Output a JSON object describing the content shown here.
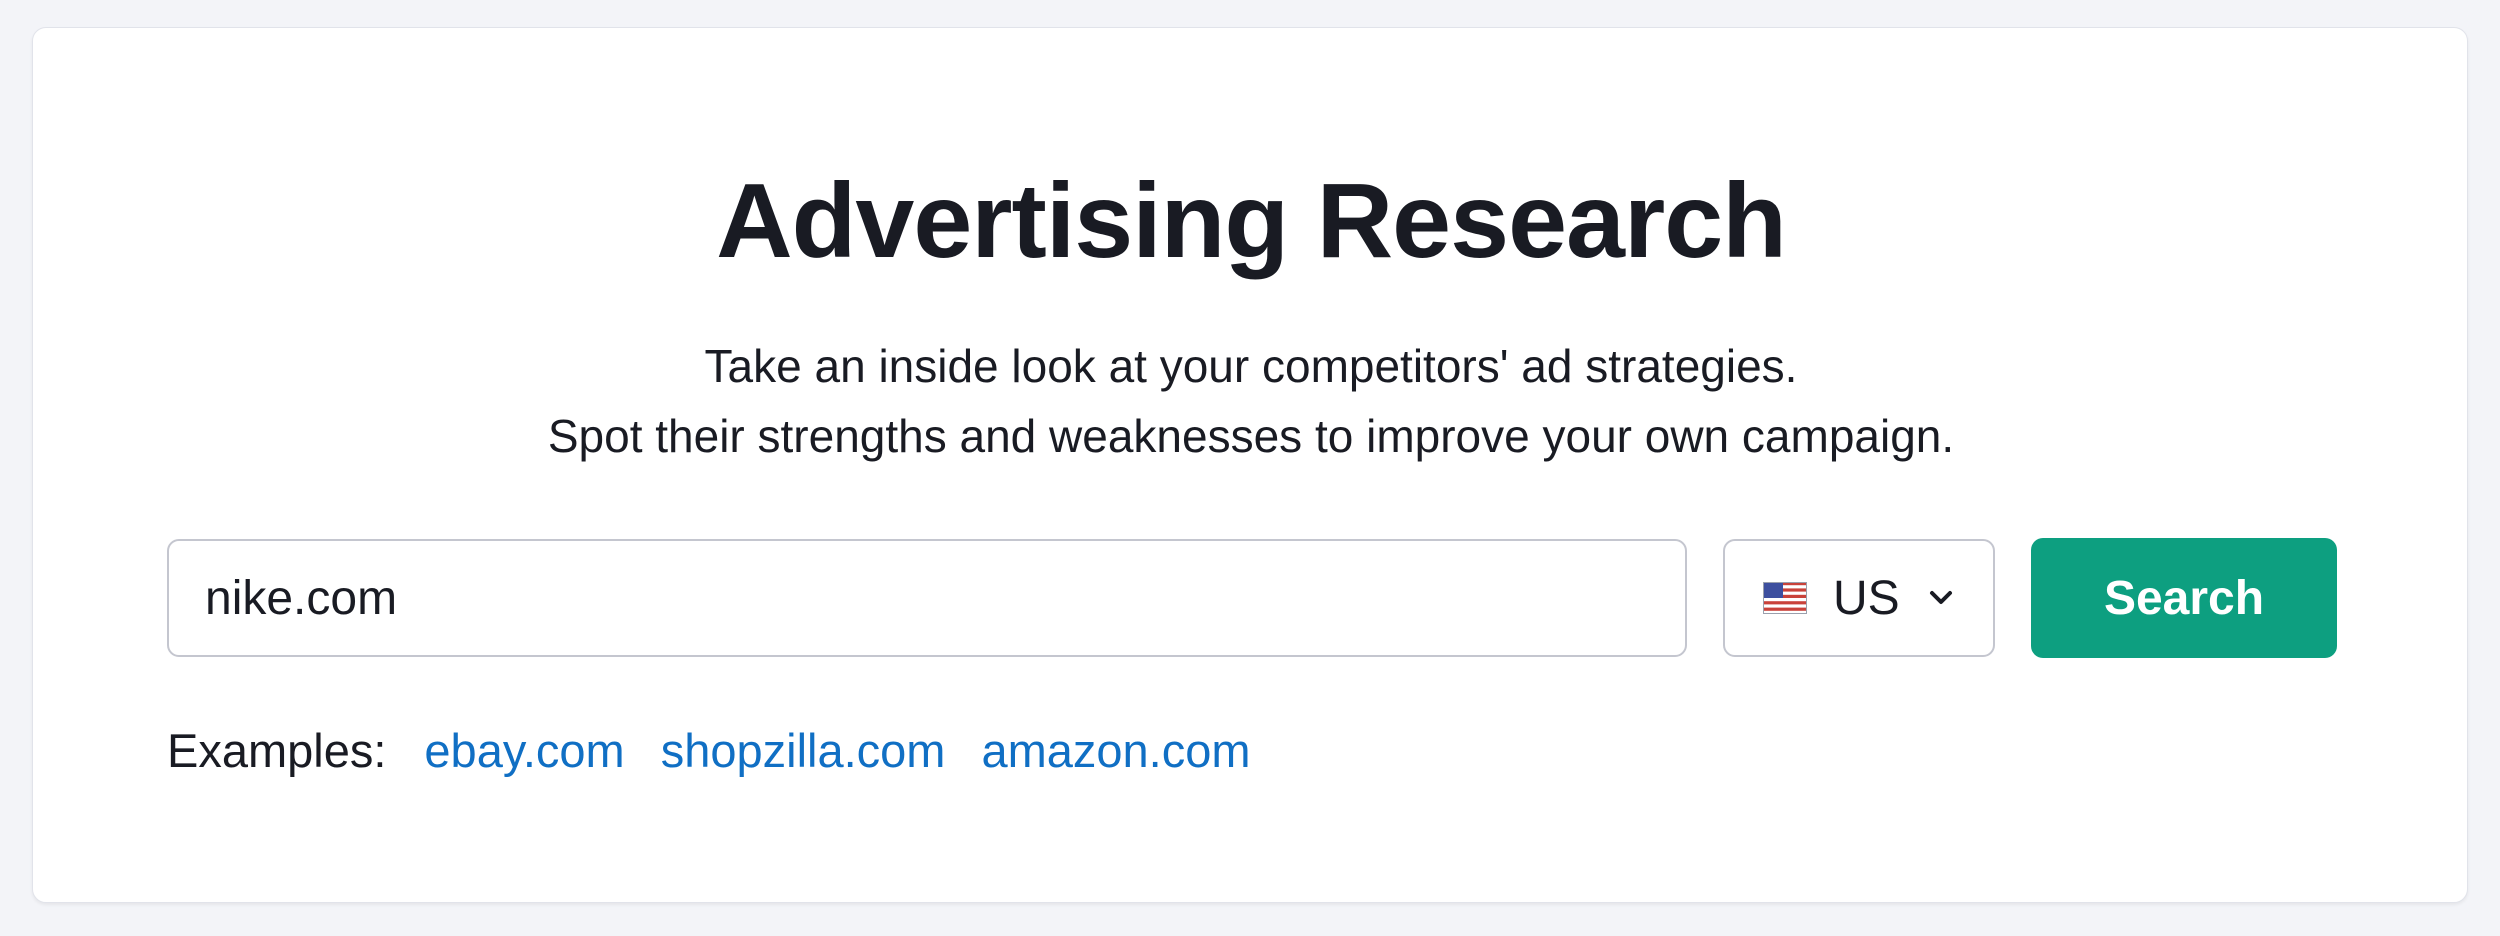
{
  "header": {
    "title": "Advertising Research",
    "subtitle_line1": "Take an inside look at your competitors' ad strategies.",
    "subtitle_line2": "Spot their strengths and weaknesses to improve your own campaign."
  },
  "search": {
    "value": "nike.com",
    "placeholder": ""
  },
  "country": {
    "selected": "US",
    "flag_icon": "us-flag-icon",
    "dropdown_icon": "chevron-down-icon"
  },
  "search_button": {
    "label": "Search"
  },
  "examples": {
    "label": "Examples:",
    "links": [
      "ebay.com",
      "shopzilla.com",
      "amazon.com"
    ]
  },
  "colors": {
    "accent": "#0d9f80",
    "link": "#106fc4",
    "text": "#191b23",
    "background": "#f3f4f8"
  }
}
